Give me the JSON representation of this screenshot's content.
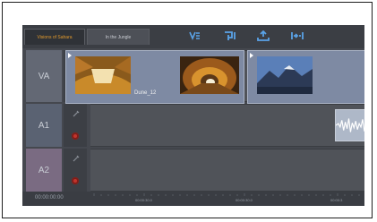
{
  "tabs": [
    {
      "label": "Visions of Sahara",
      "active": true
    },
    {
      "label": "In the Jungle",
      "active": false
    }
  ],
  "toolbar": {
    "icons": [
      "split-icon",
      "insert-icon",
      "lift-icon",
      "trim-icon"
    ],
    "icon_color": "#5aa3e8"
  },
  "tracks": [
    {
      "label": "VA"
    },
    {
      "label": "A1"
    },
    {
      "label": "A2"
    }
  ],
  "clips": [
    {
      "label": "Dune_12"
    }
  ],
  "timecode": "00:00:00:00",
  "ruler": {
    "labels": [
      "00:00:30.0",
      "00:00:30.0",
      "00:00:3"
    ]
  },
  "colors": {
    "active_tab_text": "#e39a2c",
    "record_button": "#c2342d"
  }
}
